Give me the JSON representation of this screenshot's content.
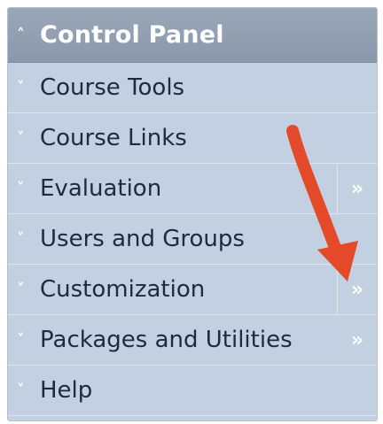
{
  "panel": {
    "header": {
      "icon": "chevron-up-icon",
      "title": "Control Panel"
    },
    "items": [
      {
        "label": "Course Tools",
        "icon": "chevron-down-icon",
        "submenu": false
      },
      {
        "label": "Course Links",
        "icon": "chevron-down-icon",
        "submenu": false
      },
      {
        "label": "Evaluation",
        "icon": "chevron-down-icon",
        "submenu": true,
        "submenu_icon": "double-chevron-right-icon"
      },
      {
        "label": "Users and Groups",
        "icon": "chevron-down-icon",
        "submenu": false
      },
      {
        "label": "Customization",
        "icon": "chevron-down-icon",
        "submenu": true,
        "submenu_icon": "double-chevron-right-icon"
      },
      {
        "label": "Packages and Utilities",
        "icon": "chevron-down-icon",
        "submenu": true,
        "submenu_icon": "double-chevron-right-icon"
      },
      {
        "label": "Help",
        "icon": "chevron-down-icon",
        "submenu": false
      }
    ]
  },
  "annotation": {
    "icon": "red-arrow-icon",
    "color": "#e4492a"
  },
  "colors": {
    "panel_bg": "#c2d0e2",
    "header_bg": "#8e9bae",
    "label_text": "#1f2a3a",
    "divider": "#dfe6ef"
  }
}
